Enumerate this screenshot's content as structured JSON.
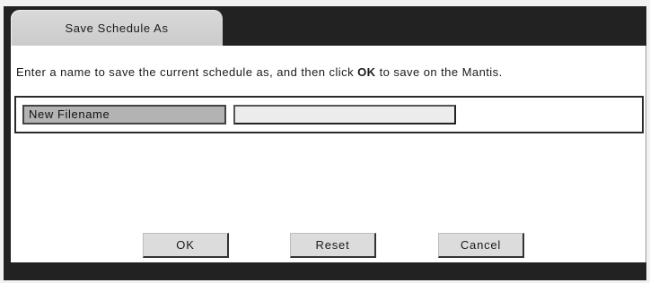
{
  "dialog": {
    "tab_title": "Save Schedule As",
    "instructions": {
      "before": "Enter a name to save the current schedule as, and then click ",
      "bold": "OK",
      "after": " to save on the Mantis."
    },
    "form": {
      "filename_label": "New Filename",
      "filename_value": "",
      "filename_placeholder": ""
    },
    "buttons": {
      "ok": "OK",
      "reset": "Reset",
      "cancel": "Cancel"
    }
  },
  "colors": {
    "frame": "#222222",
    "tab": "#d0d0d0",
    "label_bg": "#b3b3b3",
    "input_bg": "#ececec",
    "button_bg": "#dcdcdc"
  }
}
